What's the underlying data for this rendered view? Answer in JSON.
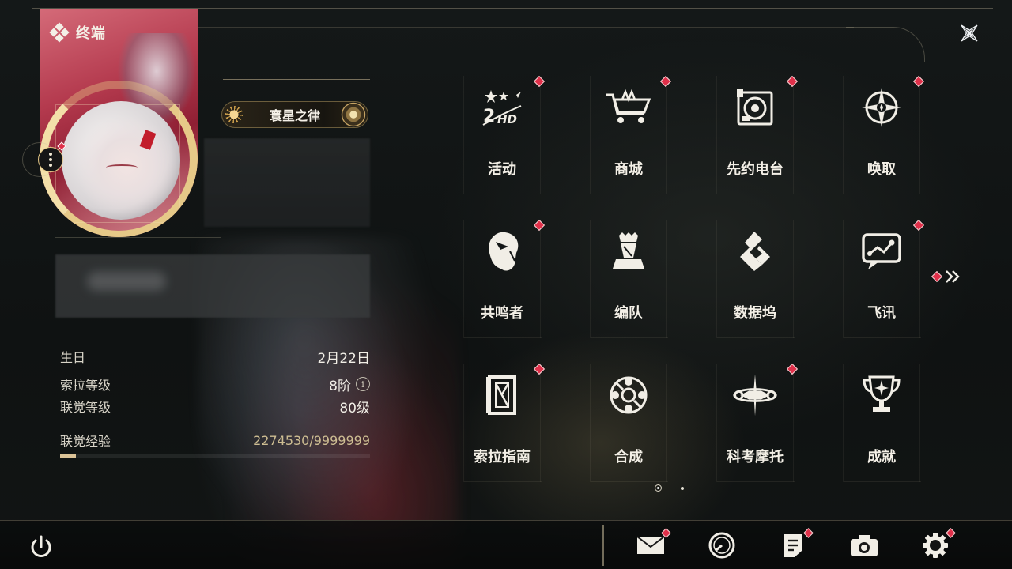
{
  "header": {
    "title": "终端"
  },
  "profile": {
    "player_title": "寰星之律"
  },
  "stats": {
    "birthday_label": "生日",
    "birthday_value": "2月22日",
    "sola_level_label": "索拉等级",
    "sola_level_value": "8阶",
    "union_level_label": "联觉等级",
    "union_level_value": "80级",
    "exp_label": "联觉经验",
    "exp_value": "2274530/9999999",
    "exp_progress": 0.2275
  },
  "menu": {
    "items": [
      {
        "label": "活动",
        "icon": "event-2hd-icon",
        "badge": true
      },
      {
        "label": "商城",
        "icon": "shop-cart-icon",
        "badge": true
      },
      {
        "label": "先约电台",
        "icon": "radio-icon",
        "badge": true
      },
      {
        "label": "唤取",
        "icon": "convene-star-icon",
        "badge": true
      },
      {
        "label": "共鸣者",
        "icon": "resonator-head-icon",
        "badge": true
      },
      {
        "label": "编队",
        "icon": "team-chess-icon",
        "badge": false
      },
      {
        "label": "数据坞",
        "icon": "data-bank-icon",
        "badge": false
      },
      {
        "label": "飞讯",
        "icon": "message-chat-icon",
        "badge": true
      },
      {
        "label": "索拉指南",
        "icon": "guidebook-icon",
        "badge": true
      },
      {
        "label": "合成",
        "icon": "synthesis-icon",
        "badge": false
      },
      {
        "label": "科考摩托",
        "icon": "motorbike-icon",
        "badge": true
      },
      {
        "label": "成就",
        "icon": "trophy-icon",
        "badge": false
      }
    ]
  },
  "pager": {
    "pages": 2,
    "current": 1
  },
  "toolbar": {
    "mail": "mail-icon",
    "events": "clock-icon",
    "notice": "notice-icon",
    "camera": "camera-icon",
    "settings": "gear-icon",
    "power": "power-icon"
  },
  "colors": {
    "accent": "#e0304a",
    "gold": "#dbc397",
    "text": "#f3efe6"
  }
}
